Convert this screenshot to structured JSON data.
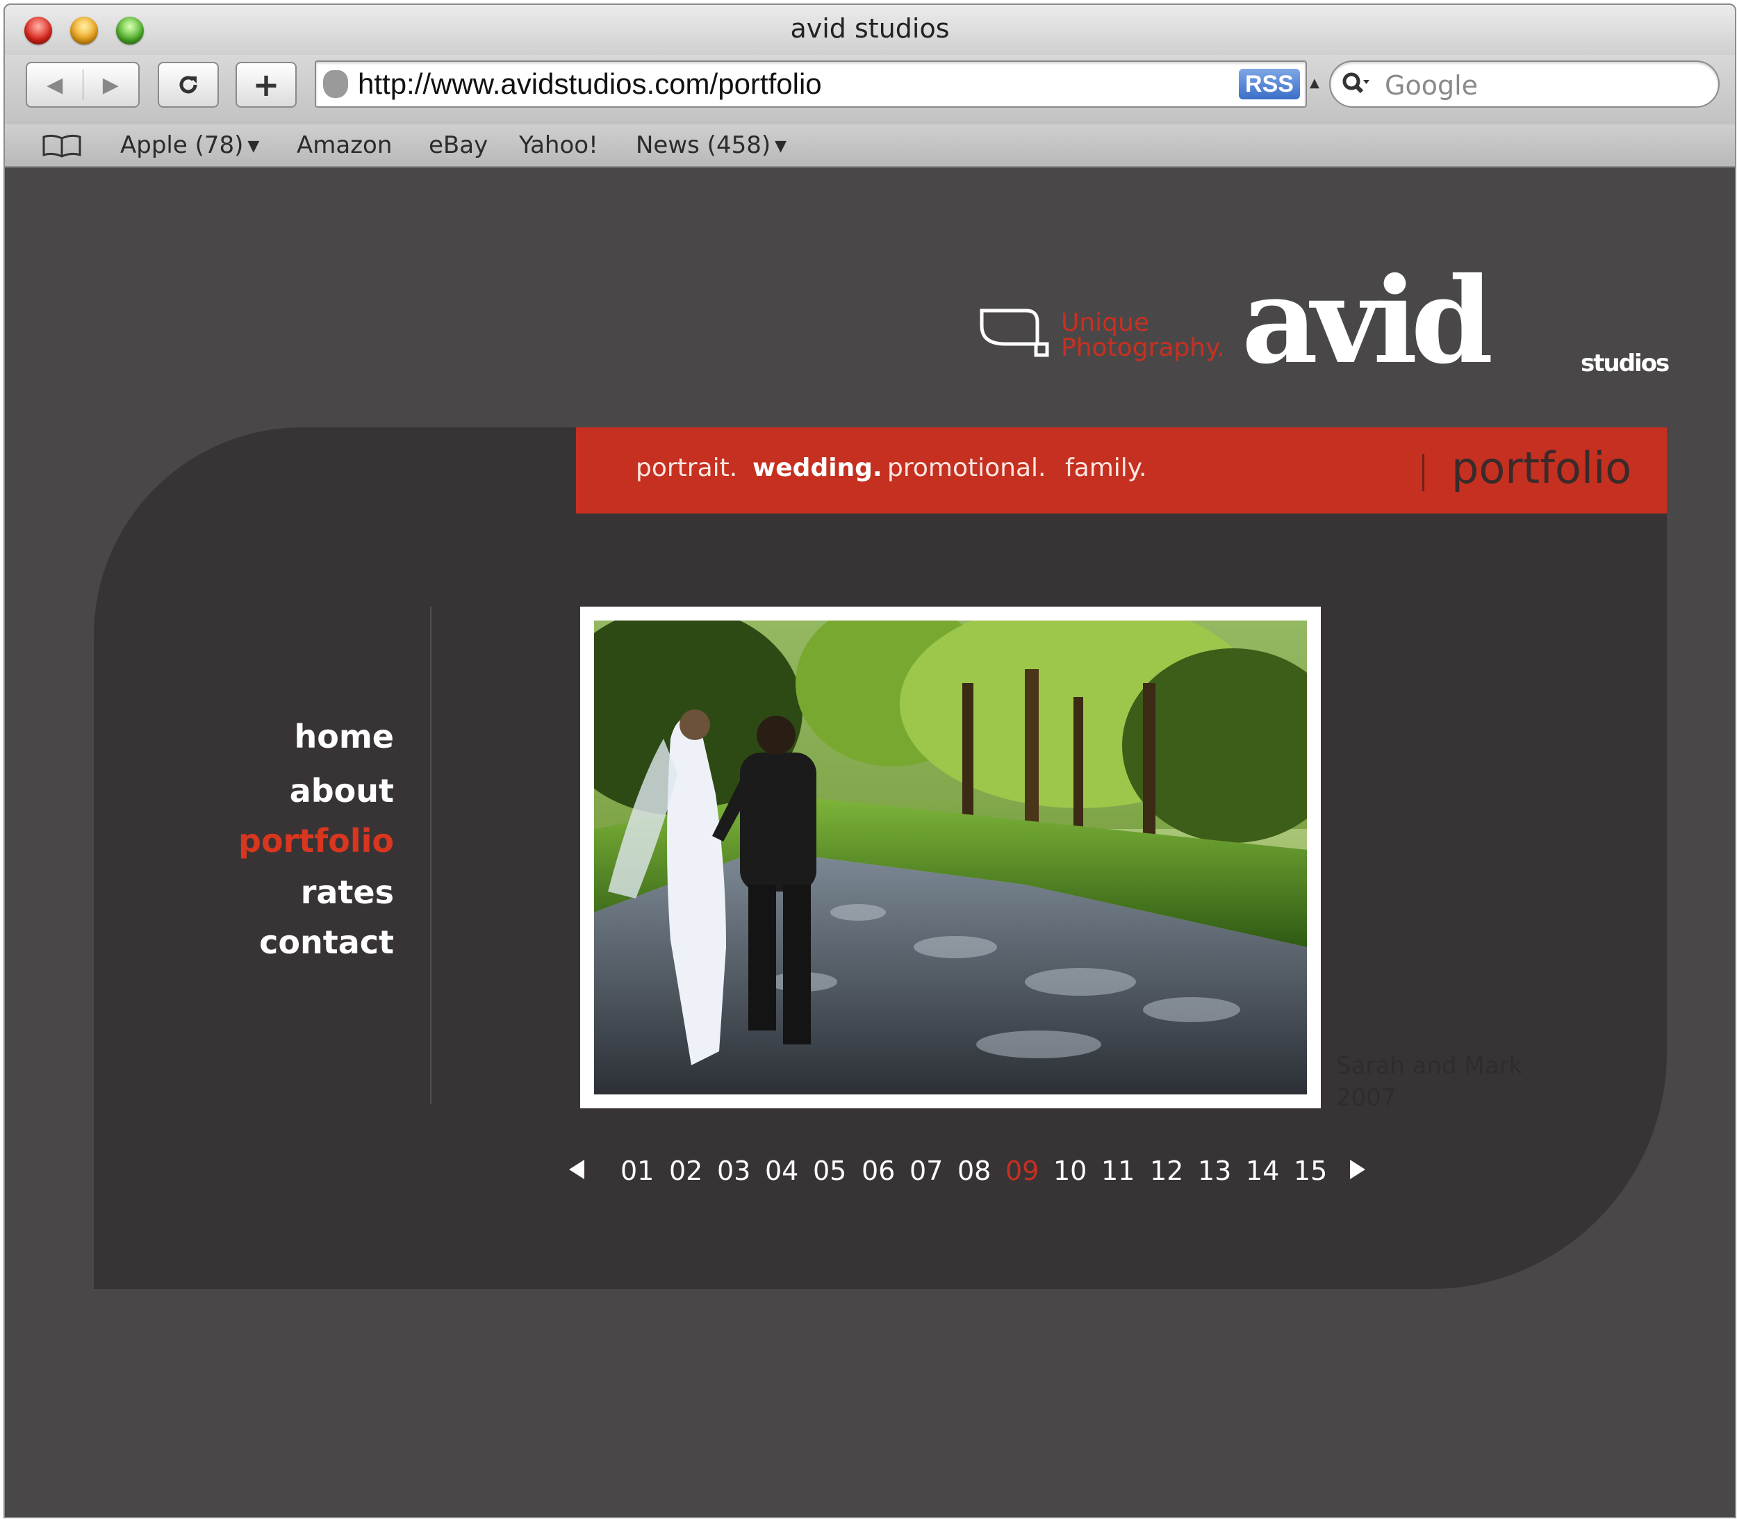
{
  "browser": {
    "title": "avid studios",
    "url": "http://www.avidstudios.com/portfolio",
    "rss_label": "RSS",
    "search_placeholder": "Google",
    "bookmarks": [
      {
        "label": "Apple (78)",
        "has_menu": true
      },
      {
        "label": "Amazon",
        "has_menu": false
      },
      {
        "label": "eBay",
        "has_menu": false
      },
      {
        "label": "Yahoo!",
        "has_menu": false
      },
      {
        "label": "News (458)",
        "has_menu": true
      }
    ],
    "icons": {
      "back": "back-arrow-icon",
      "forward": "forward-arrow-icon",
      "reload": "reload-icon",
      "add": "add-bookmark-icon",
      "search": "search-icon",
      "bookmarks": "book-icon"
    }
  },
  "site": {
    "logo": {
      "tagline_line1": "Unique",
      "tagline_line2": "Photography.",
      "brand": "avid",
      "brand_sub": "studios"
    },
    "categories": [
      {
        "label": "portrait.",
        "active": false
      },
      {
        "label": "wedding.",
        "active": true
      },
      {
        "label": "promotional.",
        "active": false
      },
      {
        "label": "family.",
        "active": false
      }
    ],
    "section_title": "portfolio",
    "nav": [
      {
        "label": "home",
        "current": false
      },
      {
        "label": "about",
        "current": false
      },
      {
        "label": "portfolio",
        "current": true
      },
      {
        "label": "rates",
        "current": false
      },
      {
        "label": "contact",
        "current": false
      }
    ],
    "photo_caption": {
      "line1": "Sarah and Mark",
      "line2": "2007"
    },
    "pager": {
      "pages": [
        "01",
        "02",
        "03",
        "04",
        "05",
        "06",
        "07",
        "08",
        "09",
        "10",
        "11",
        "12",
        "13",
        "14",
        "15"
      ],
      "current": "09"
    },
    "colors": {
      "accent_red": "#c63020",
      "background": "#4a4749",
      "panel": "#383436"
    }
  }
}
